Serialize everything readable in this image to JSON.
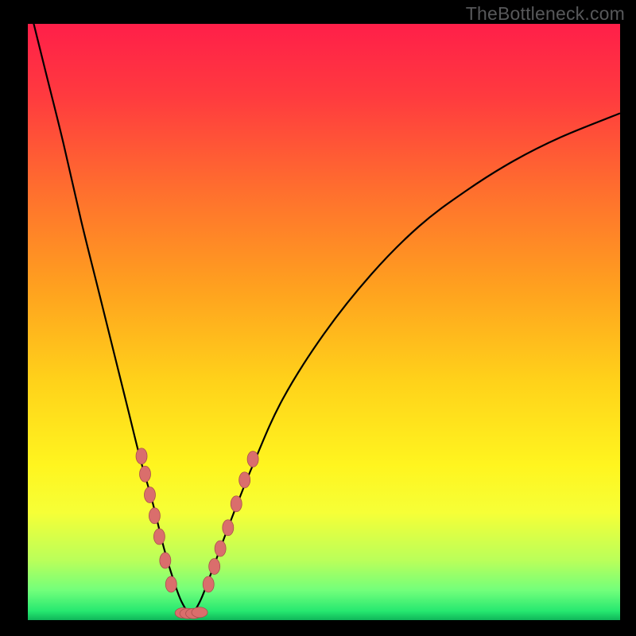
{
  "watermark": "TheBottleneck.com",
  "gradient_stops": [
    {
      "offset": 0.0,
      "color": "#ff1f49"
    },
    {
      "offset": 0.12,
      "color": "#ff3a3f"
    },
    {
      "offset": 0.28,
      "color": "#ff6f2e"
    },
    {
      "offset": 0.44,
      "color": "#ffa01f"
    },
    {
      "offset": 0.6,
      "color": "#ffd21a"
    },
    {
      "offset": 0.74,
      "color": "#fff51f"
    },
    {
      "offset": 0.82,
      "color": "#f6ff37"
    },
    {
      "offset": 0.9,
      "color": "#baff5a"
    },
    {
      "offset": 0.95,
      "color": "#72ff7b"
    },
    {
      "offset": 0.985,
      "color": "#26e870"
    },
    {
      "offset": 1.0,
      "color": "#0fb659"
    }
  ],
  "marker_color": "#da6e6c",
  "marker_stroke": "#a84f4c",
  "curve_color": "#000000",
  "chart_data": {
    "type": "line",
    "title": "",
    "xlabel": "",
    "ylabel": "",
    "xlim": [
      0,
      100
    ],
    "ylim": [
      0,
      100
    ],
    "series": [
      {
        "name": "bottleneck-curve",
        "x": [
          0,
          3,
          6,
          9,
          12,
          15,
          17,
          19,
          21,
          23,
          24.5,
          26,
          27.5,
          29,
          31,
          34,
          38,
          43,
          50,
          58,
          66,
          74,
          82,
          90,
          100
        ],
        "y": [
          104,
          92,
          80,
          67,
          55,
          43,
          35,
          27,
          20,
          12,
          7,
          3,
          1.2,
          3,
          8,
          16,
          26,
          37,
          48,
          58,
          66,
          72,
          77,
          81,
          85
        ]
      }
    ],
    "markers_left": {
      "name": "left-branch-markers",
      "x": [
        19.2,
        19.8,
        20.6,
        21.4,
        22.2,
        23.2,
        24.2
      ],
      "y": [
        27.5,
        24.5,
        21,
        17.5,
        14,
        10,
        6
      ]
    },
    "markers_bottom": {
      "name": "valley-markers",
      "x": [
        26.2,
        27.0,
        28.0,
        29.0
      ],
      "y": [
        1.2,
        1.1,
        1.1,
        1.3
      ]
    },
    "markers_right": {
      "name": "right-branch-markers",
      "x": [
        30.5,
        31.5,
        32.5,
        33.8,
        35.2,
        36.6,
        38.0
      ],
      "y": [
        6,
        9,
        12,
        15.5,
        19.5,
        23.5,
        27
      ]
    }
  }
}
